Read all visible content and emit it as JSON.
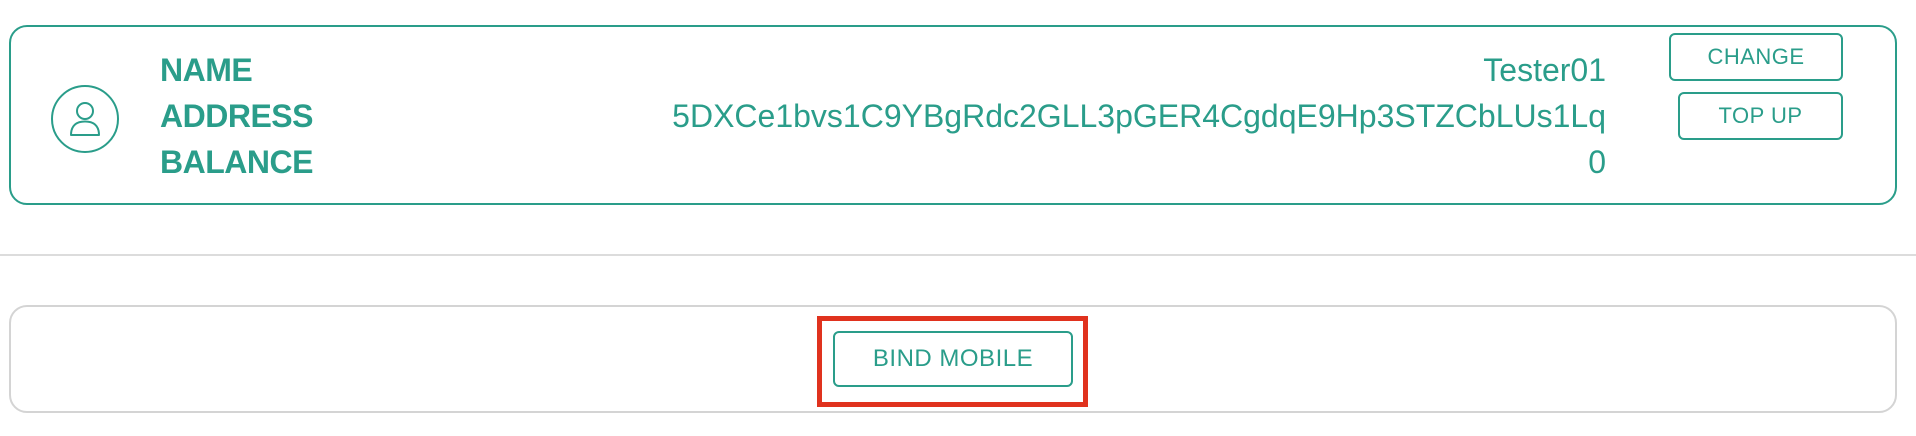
{
  "account": {
    "labels": {
      "name": "NAME",
      "address": "ADDRESS",
      "balance": "BALANCE"
    },
    "values": {
      "name": "Tester01",
      "address": "5DXCe1bvs1C9YBgRdc2GLL3pGER4CgdqE9Hp3STZCbLUs1Lq",
      "balance": "0"
    },
    "avatar_icon": "user-icon",
    "buttons": {
      "change": "CHANGE",
      "top_up": "TOP UP"
    }
  },
  "bind": {
    "button_label": "BIND MOBILE",
    "highlighted": true
  },
  "colors": {
    "accent": "#2a9d8a",
    "highlight": "#e0321e",
    "divider": "#dcdcdc"
  }
}
